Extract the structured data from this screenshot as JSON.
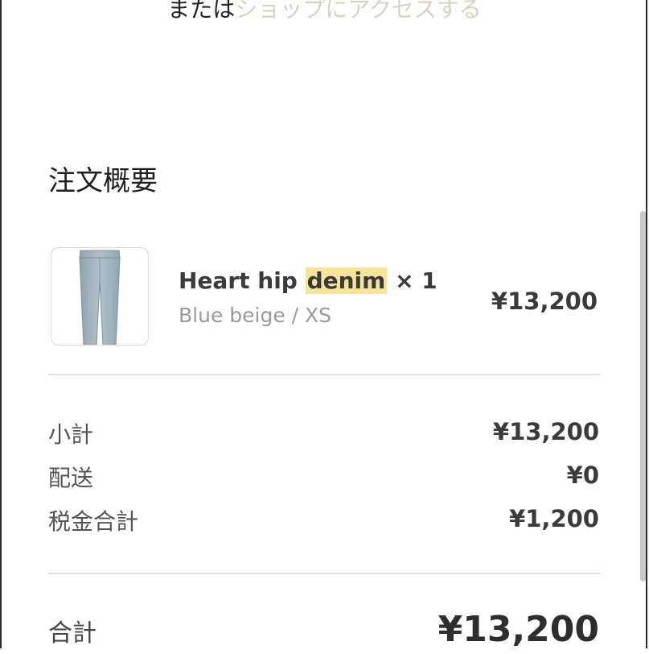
{
  "header": {
    "prefix": "または",
    "shop_link": "ショップにアクセスする"
  },
  "summary": {
    "title": "注文概要"
  },
  "item": {
    "image_icon": "denim-jeans-image",
    "name_before": "Heart hip ",
    "name_highlight": "denim",
    "name_after": " × 1",
    "variant": "Blue beige / XS",
    "price": "¥13,200"
  },
  "totals": {
    "subtotal_label": "小計",
    "subtotal_value": "¥13,200",
    "shipping_label": "配送",
    "shipping_value": "¥0",
    "tax_label": "税金合計",
    "tax_value": "¥1,200",
    "total_label": "合計",
    "total_value": "¥13,200"
  },
  "colors": {
    "link": "#d8d2bf",
    "highlight": "#f7e39a",
    "muted_text": "#9a9a9a"
  }
}
